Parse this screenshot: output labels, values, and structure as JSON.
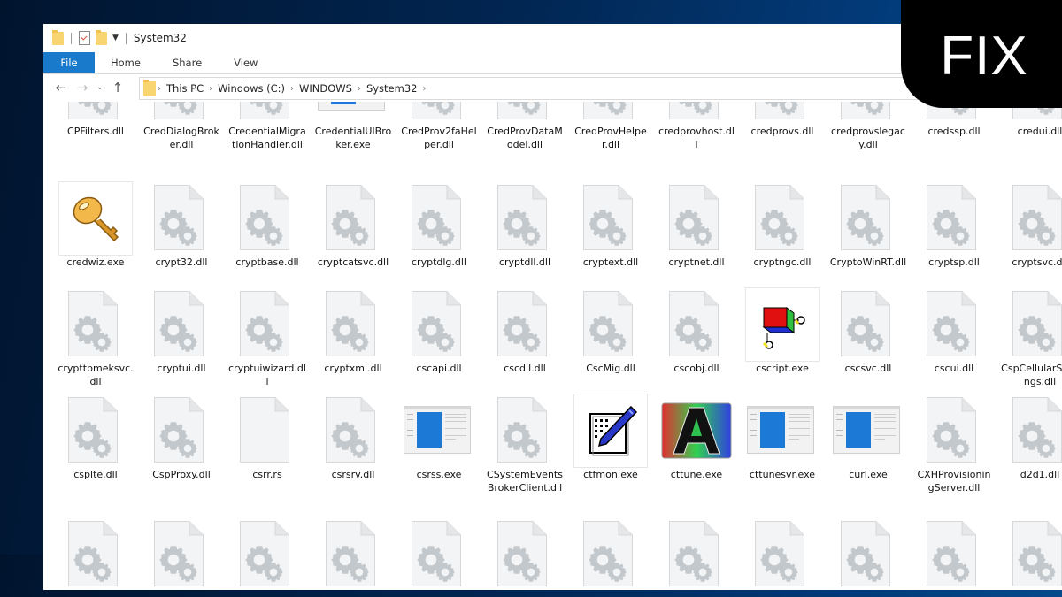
{
  "window": {
    "title": "System32",
    "ribbon_tabs": [
      "File",
      "Home",
      "Share",
      "View"
    ],
    "address": {
      "crumbs": [
        "This PC",
        "Windows (C:)",
        "WINDOWS",
        "System32"
      ]
    }
  },
  "badge": {
    "text": "FIX"
  },
  "files": [
    {
      "name": "CPFilters.dll",
      "icon": "dll"
    },
    {
      "name": "CredDialogBroker.dll",
      "icon": "dll"
    },
    {
      "name": "CredentialMigrationHandler.dll",
      "icon": "dll"
    },
    {
      "name": "CredentialUIBroker.exe",
      "icon": "app-window"
    },
    {
      "name": "CredProv2faHelper.dll",
      "icon": "dll"
    },
    {
      "name": "CredProvDataModel.dll",
      "icon": "dll"
    },
    {
      "name": "CredProvHelper.dll",
      "icon": "dll"
    },
    {
      "name": "credprovhost.dll",
      "icon": "dll"
    },
    {
      "name": "credprovs.dll",
      "icon": "dll"
    },
    {
      "name": "credprovslegacy.dll",
      "icon": "dll"
    },
    {
      "name": "credssp.dll",
      "icon": "dll"
    },
    {
      "name": "credui.dll",
      "icon": "dll"
    },
    {
      "name": "credwiz.exe",
      "icon": "key"
    },
    {
      "name": "crypt32.dll",
      "icon": "dll"
    },
    {
      "name": "cryptbase.dll",
      "icon": "dll"
    },
    {
      "name": "cryptcatsvc.dll",
      "icon": "dll"
    },
    {
      "name": "cryptdlg.dll",
      "icon": "dll"
    },
    {
      "name": "cryptdll.dll",
      "icon": "dll"
    },
    {
      "name": "cryptext.dll",
      "icon": "dll"
    },
    {
      "name": "cryptnet.dll",
      "icon": "dll"
    },
    {
      "name": "cryptngc.dll",
      "icon": "dll"
    },
    {
      "name": "CryptoWinRT.dll",
      "icon": "dll"
    },
    {
      "name": "cryptsp.dll",
      "icon": "dll"
    },
    {
      "name": "cryptsvc.dll",
      "icon": "dll"
    },
    {
      "name": "crypttpmeksvc.dll",
      "icon": "dll"
    },
    {
      "name": "cryptui.dll",
      "icon": "dll"
    },
    {
      "name": "cryptuiwizard.dll",
      "icon": "dll"
    },
    {
      "name": "cryptxml.dll",
      "icon": "dll"
    },
    {
      "name": "cscapi.dll",
      "icon": "dll"
    },
    {
      "name": "cscdll.dll",
      "icon": "dll"
    },
    {
      "name": "CscMig.dll",
      "icon": "dll"
    },
    {
      "name": "cscobj.dll",
      "icon": "dll"
    },
    {
      "name": "cscript.exe",
      "icon": "script-cube"
    },
    {
      "name": "cscsvc.dll",
      "icon": "dll"
    },
    {
      "name": "cscui.dll",
      "icon": "dll"
    },
    {
      "name": "CspCellularSettings.dll",
      "icon": "dll"
    },
    {
      "name": "csplte.dll",
      "icon": "dll"
    },
    {
      "name": "CspProxy.dll",
      "icon": "dll"
    },
    {
      "name": "csrr.rs",
      "icon": "blank-file"
    },
    {
      "name": "csrsrv.dll",
      "icon": "dll"
    },
    {
      "name": "csrss.exe",
      "icon": "app-window"
    },
    {
      "name": "CSystemEventsBrokerClient.dll",
      "icon": "dll"
    },
    {
      "name": "ctfmon.exe",
      "icon": "pen-pad"
    },
    {
      "name": "cttune.exe",
      "icon": "cleartype-a"
    },
    {
      "name": "cttunesvr.exe",
      "icon": "app-window"
    },
    {
      "name": "curl.exe",
      "icon": "app-window"
    },
    {
      "name": "CXHProvisioningServer.dll",
      "icon": "dll"
    },
    {
      "name": "d2d1.dll",
      "icon": "dll"
    },
    {
      "name": "",
      "icon": "dll"
    },
    {
      "name": "",
      "icon": "dll"
    },
    {
      "name": "",
      "icon": "dll"
    },
    {
      "name": "",
      "icon": "dll"
    },
    {
      "name": "",
      "icon": "dll"
    },
    {
      "name": "",
      "icon": "dll"
    },
    {
      "name": "",
      "icon": "dll"
    },
    {
      "name": "",
      "icon": "dll"
    },
    {
      "name": "",
      "icon": "dll"
    },
    {
      "name": "",
      "icon": "dll"
    },
    {
      "name": "",
      "icon": "dll"
    },
    {
      "name": "",
      "icon": "dll"
    }
  ]
}
